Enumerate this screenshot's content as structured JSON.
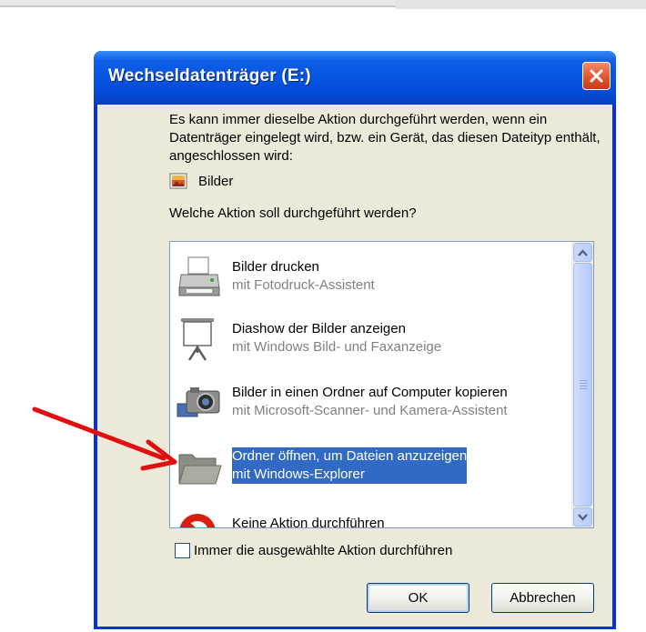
{
  "window": {
    "title": "Wechseldatenträger (E:)"
  },
  "dialog": {
    "description": "Es kann immer dieselbe Aktion durchgeführt werden, wenn ein Datenträger eingelegt wird, bzw. ein Gerät, das diesen Dateityp enthält, angeschlossen wird:",
    "content_type": "Bilder",
    "question": "Welche Aktion soll durchgeführt werden?"
  },
  "actions": [
    {
      "title": "Bilder drucken",
      "subtitle": "mit Fotodruck-Assistent",
      "icon": "printer-icon"
    },
    {
      "title": "Diashow der Bilder anzeigen",
      "subtitle": "mit Windows Bild- und Faxanzeige",
      "icon": "projector-screen-icon"
    },
    {
      "title": "Bilder in einen Ordner auf Computer kopieren",
      "subtitle": "mit Microsoft-Scanner- und Kamera-Assistent",
      "icon": "camera-icon"
    },
    {
      "title": "Ordner öffnen, um Dateien anzuzeigen",
      "subtitle": "mit Windows-Explorer",
      "icon": "folder-icon",
      "selected": true
    },
    {
      "title": "Keine Aktion durchführen",
      "icon": "no-action-icon"
    }
  ],
  "checkbox": {
    "label": "Immer die ausgewählte Aktion durchführen",
    "checked": false
  },
  "buttons": {
    "ok": "OK",
    "cancel": "Abbrechen"
  },
  "colors": {
    "titlebar": "#0553e0",
    "selection": "#316ac5",
    "annotation_arrow": "#e01010"
  }
}
